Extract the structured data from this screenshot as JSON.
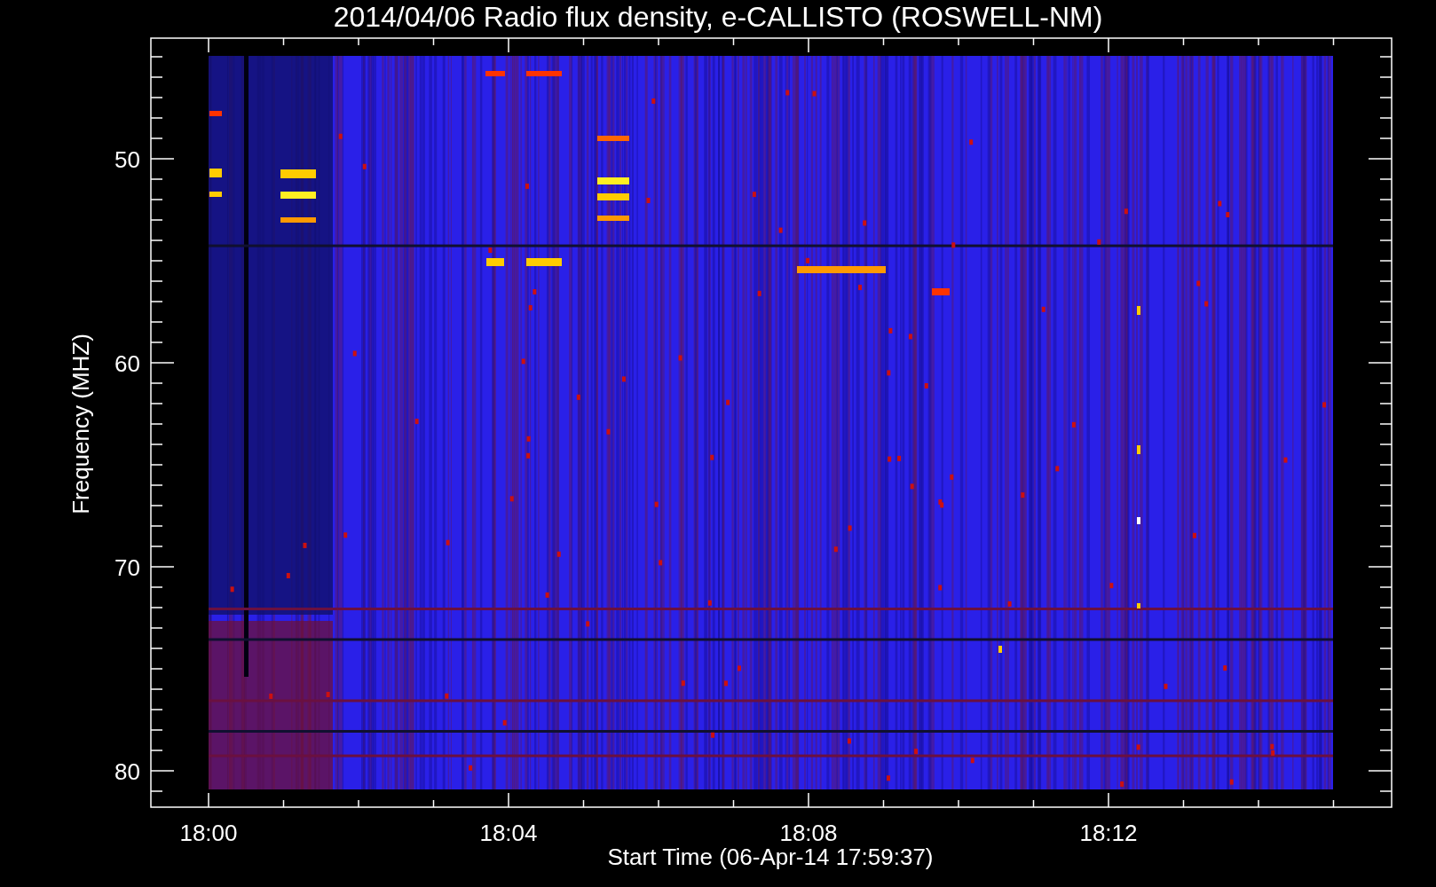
{
  "title": "2014/04/06  Radio flux density, e-CALLISTO (ROSWELL-NM)",
  "x_axis": {
    "label": "Start Time (06-Apr-14 17:59:37)",
    "ticks": [
      "18:00",
      "18:04",
      "18:08",
      "18:12"
    ]
  },
  "y_axis": {
    "label": "Frequency (MHZ)",
    "ticks": [
      "50",
      "60",
      "70",
      "80"
    ]
  }
}
